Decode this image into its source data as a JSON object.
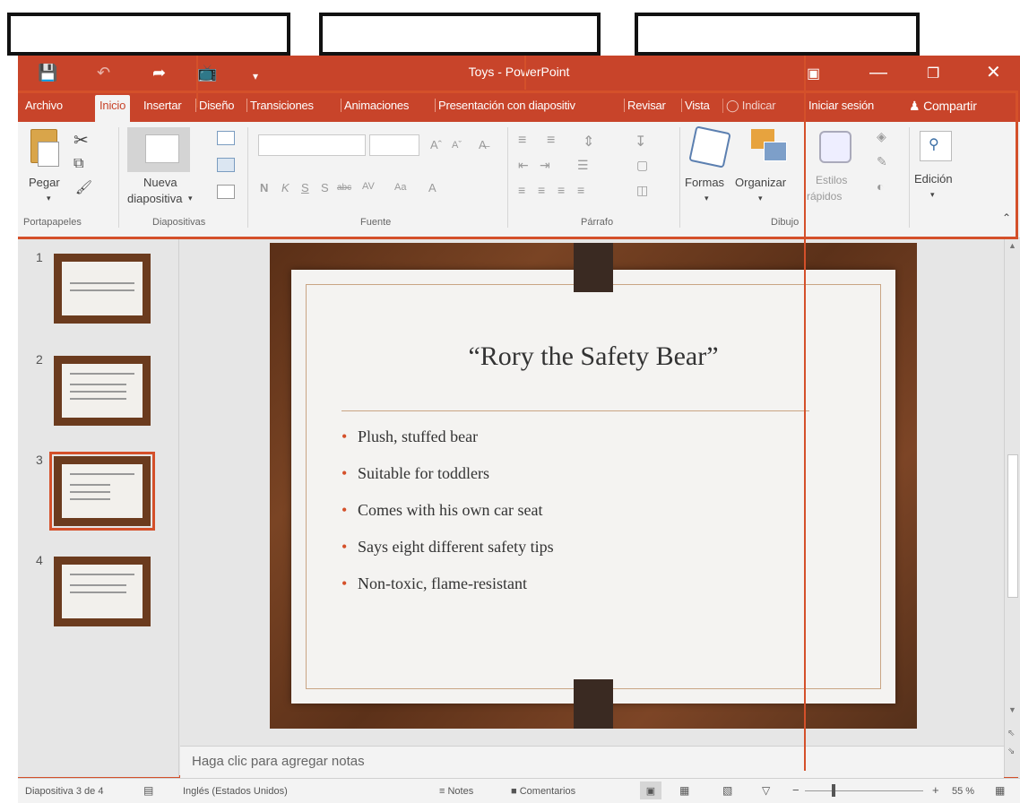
{
  "window": {
    "title": "Toys - PowerPoint"
  },
  "quick_access": {
    "save_icon": "save-icon",
    "undo_icon": "undo-icon",
    "redo_icon": "redo-icon",
    "present_icon": "start-presentation-icon",
    "customize_icon": "customize-icon"
  },
  "window_controls": {
    "ribbon_display": "ribbon-display-icon",
    "minimize": "minimize-icon",
    "restore": "restore-icon",
    "close": "close-icon"
  },
  "tabs": [
    "Archivo",
    "Inicio",
    "Insertar",
    "Diseño",
    "Transiciones",
    "Animaciones",
    "Presentación con diapositiv",
    "Revisar",
    "Vista",
    "Indicar",
    "Iniciar sesión",
    "Compartir"
  ],
  "ribbon": {
    "paste_label": "Pegar",
    "new_slide_label_1": "Nueva",
    "new_slide_label_2": "diapositiva",
    "shapes_label": "Formas",
    "arrange_label": "Organizar",
    "styles_label_1": "Estilos",
    "styles_label_2": "rápidos",
    "editing_label": "Edición",
    "font_bold": "N",
    "font_italic": "K",
    "font_underline": "S",
    "font_strike": "S",
    "font_abc": "abc",
    "font_av": "AV",
    "font_aa": "Aa",
    "font_color": "A",
    "groups": [
      "Portapapeles",
      "Diapositivas",
      "Fuente",
      "Párrafo",
      "Dibujo"
    ]
  },
  "thumbnails": [
    "1",
    "2",
    "3",
    "4"
  ],
  "slide": {
    "title": "“Rory the Safety Bear”",
    "bullets": [
      "Plush, stuffed bear",
      "Suitable for toddlers",
      "Comes with his own car seat",
      "Says eight different safety tips",
      "Non-toxic, flame-resistant"
    ]
  },
  "notes_placeholder": "Haga clic para agregar notas",
  "status": {
    "slide_counter": "Diapositiva 3 de 4",
    "language": "Inglés (Estados Unidos)",
    "notes": "Notes",
    "comments": "Comentarios",
    "zoom": "55 %"
  },
  "colors": {
    "accent": "#c8442a",
    "annotation": "#d4502a"
  }
}
